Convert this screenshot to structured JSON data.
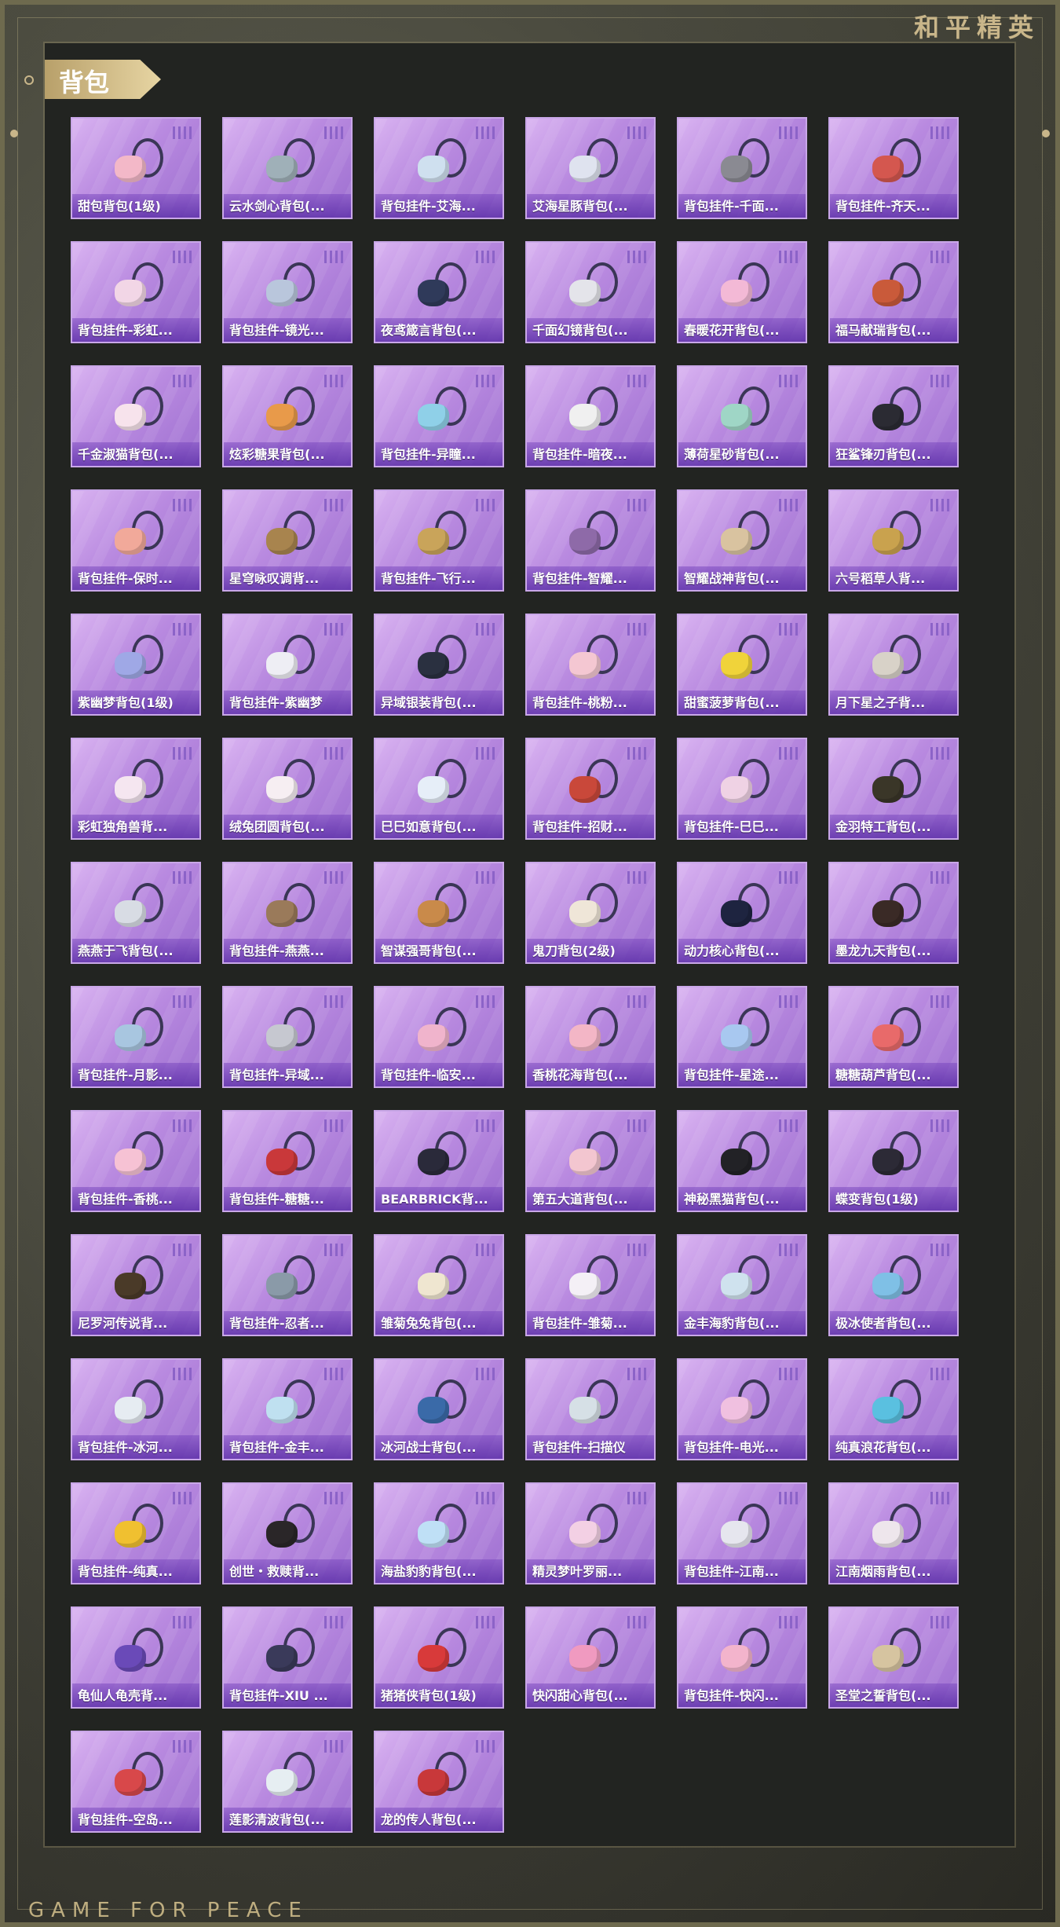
{
  "brand": "和平精英",
  "footer_brand": "GAME FOR PEACE",
  "page_title": "背包",
  "items": [
    {
      "label": "甜包背包(1级)",
      "color": "#f3b8c8"
    },
    {
      "label": "云水剑心背包(...",
      "color": "#9fb0b8"
    },
    {
      "label": "背包挂件-艾海...",
      "color": "#cfe0ef"
    },
    {
      "label": "艾海星豚背包(...",
      "color": "#dfe3ef"
    },
    {
      "label": "背包挂件-千面...",
      "color": "#8a8a92"
    },
    {
      "label": "背包挂件-齐天...",
      "color": "#d4574f"
    },
    {
      "label": "背包挂件-彩虹...",
      "color": "#f2d6e6"
    },
    {
      "label": "背包挂件-镜光...",
      "color": "#b9c6dc"
    },
    {
      "label": "夜鸢箴言背包(...",
      "color": "#2f3a5a"
    },
    {
      "label": "千面幻镜背包(...",
      "color": "#e4e4ea"
    },
    {
      "label": "春暖花开背包(...",
      "color": "#f3b9d6"
    },
    {
      "label": "福马献瑞背包(...",
      "color": "#c95a3a"
    },
    {
      "label": "千金淑猫背包(...",
      "color": "#f7e3ec"
    },
    {
      "label": "炫彩糖果背包(...",
      "color": "#e89a4a"
    },
    {
      "label": "背包挂件-异瞳...",
      "color": "#8fd0e8"
    },
    {
      "label": "背包挂件-暗夜...",
      "color": "#f0f0f0"
    },
    {
      "label": "薄荷星砂背包(...",
      "color": "#9fd6c6"
    },
    {
      "label": "狂鲨锋刃背包(...",
      "color": "#2b2b33"
    },
    {
      "label": "背包挂件-保时...",
      "color": "#f1a99a"
    },
    {
      "label": "星穹咏叹调背...",
      "color": "#a8844e"
    },
    {
      "label": "背包挂件-飞行...",
      "color": "#c9a45a"
    },
    {
      "label": "背包挂件-智耀...",
      "color": "#8e6aa8"
    },
    {
      "label": "智耀战神背包(...",
      "color": "#d9c3a0"
    },
    {
      "label": "六号稻草人背...",
      "color": "#c9a24e"
    },
    {
      "label": "紫幽梦背包(1级)",
      "color": "#9fa8e6"
    },
    {
      "label": "背包挂件-紫幽梦",
      "color": "#eeeef4"
    },
    {
      "label": "异域银装背包(...",
      "color": "#2a3040"
    },
    {
      "label": "背包挂件-桃粉...",
      "color": "#f4c7d2"
    },
    {
      "label": "甜蜜菠萝背包(...",
      "color": "#f0d33a"
    },
    {
      "label": "月下星之子背...",
      "color": "#d8d2c8"
    },
    {
      "label": "彩虹独角兽背...",
      "color": "#f5e6f0"
    },
    {
      "label": "绒兔团圆背包(...",
      "color": "#f6eef2"
    },
    {
      "label": "巳巳如意背包(...",
      "color": "#e6eef8"
    },
    {
      "label": "背包挂件-招财...",
      "color": "#c9483a"
    },
    {
      "label": "背包挂件-巳巳...",
      "color": "#efd2e4"
    },
    {
      "label": "金羽特工背包(...",
      "color": "#3a3628"
    },
    {
      "label": "燕燕于飞背包(...",
      "color": "#d8dce4"
    },
    {
      "label": "背包挂件-燕燕...",
      "color": "#9a7a5a"
    },
    {
      "label": "智谋强哥背包(...",
      "color": "#c98a4a"
    },
    {
      "label": "鬼刀背包(2级)",
      "color": "#efe6d8"
    },
    {
      "label": "动力核心背包(...",
      "color": "#1e2440"
    },
    {
      "label": "墨龙九天背包(...",
      "color": "#3a2a26"
    },
    {
      "label": "背包挂件-月影...",
      "color": "#a8c6e0"
    },
    {
      "label": "背包挂件-异域...",
      "color": "#c6c8d0"
    },
    {
      "label": "背包挂件-临安...",
      "color": "#f0b4cc"
    },
    {
      "label": "香桃花海背包(...",
      "color": "#f3b6c6"
    },
    {
      "label": "背包挂件-星途...",
      "color": "#a8c8f0"
    },
    {
      "label": "糖糖葫芦背包(...",
      "color": "#e86a6a"
    },
    {
      "label": "背包挂件-香桃...",
      "color": "#f6c2d4"
    },
    {
      "label": "背包挂件-糖糖...",
      "color": "#c9383a"
    },
    {
      "label": "BEARBRICK背...",
      "color": "#2a2a3a"
    },
    {
      "label": "第五大道背包(...",
      "color": "#f3c6d0"
    },
    {
      "label": "神秘黑猫背包(...",
      "color": "#222226"
    },
    {
      "label": "蝶变背包(1级)",
      "color": "#2c2a36"
    },
    {
      "label": "尼罗河传说背...",
      "color": "#4a3a28"
    },
    {
      "label": "背包挂件-忍者...",
      "color": "#8a9aa8"
    },
    {
      "label": "雏菊兔兔背包(...",
      "color": "#efe6d0"
    },
    {
      "label": "背包挂件-雏菊...",
      "color": "#f4f0f6"
    },
    {
      "label": "金丰海豹背包(...",
      "color": "#cfe2ee"
    },
    {
      "label": "极冰使者背包(...",
      "color": "#7fc0e6"
    },
    {
      "label": "背包挂件-冰河...",
      "color": "#e6ecf2"
    },
    {
      "label": "背包挂件-金丰...",
      "color": "#bfe0f0"
    },
    {
      "label": "冰河战士背包(...",
      "color": "#3a6aa8"
    },
    {
      "label": "背包挂件-扫描仪",
      "color": "#d6e0e6"
    },
    {
      "label": "背包挂件-电光...",
      "color": "#f0c0e0"
    },
    {
      "label": "纯真浪花背包(...",
      "color": "#5ac0e0"
    },
    {
      "label": "背包挂件-纯真...",
      "color": "#f0c030"
    },
    {
      "label": "创世・救赎背...",
      "color": "#2a2628"
    },
    {
      "label": "海盐豹豹背包(...",
      "color": "#bfe0f6"
    },
    {
      "label": "精灵梦叶罗丽...",
      "color": "#f3d0e4"
    },
    {
      "label": "背包挂件-江南...",
      "color": "#e6e6ee"
    },
    {
      "label": "江南烟雨背包(...",
      "color": "#eee6ec"
    },
    {
      "label": "龟仙人龟壳背...",
      "color": "#6a4ab8"
    },
    {
      "label": "背包挂件-XIU ...",
      "color": "#3a3a5a"
    },
    {
      "label": "猪猪侠背包(1级)",
      "color": "#d83a3a"
    },
    {
      "label": "快闪甜心背包(...",
      "color": "#f09ac0"
    },
    {
      "label": "背包挂件-快闪...",
      "color": "#f3b4cc"
    },
    {
      "label": "圣堂之誓背包(...",
      "color": "#d6c4a0"
    },
    {
      "label": "背包挂件-空岛...",
      "color": "#d8484a"
    },
    {
      "label": "莲影清波背包(...",
      "color": "#e6eef2"
    },
    {
      "label": "龙的传人背包(...",
      "color": "#c8383a"
    }
  ]
}
